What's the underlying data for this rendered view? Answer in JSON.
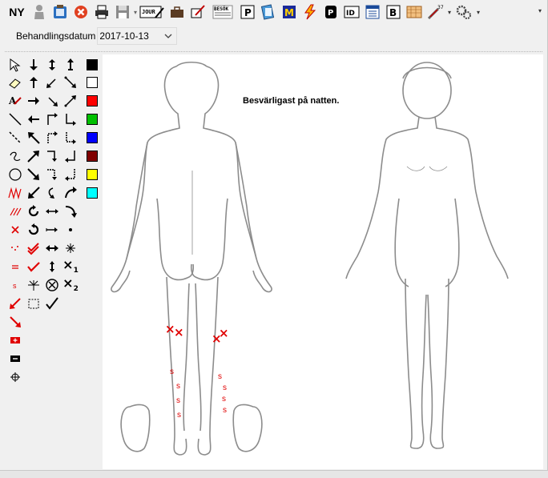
{
  "toolbar": {
    "new_label": "NY",
    "items": [
      {
        "name": "user-icon"
      },
      {
        "name": "record-icon"
      },
      {
        "name": "delete-icon"
      },
      {
        "name": "print-icon"
      },
      {
        "name": "save-icon"
      },
      {
        "name": "journal-icon",
        "text": "JOUR"
      },
      {
        "name": "briefcase-icon"
      },
      {
        "name": "sign-icon"
      },
      {
        "name": "visit-icon",
        "text": "BESÖK"
      },
      {
        "name": "p-icon",
        "text": "P"
      },
      {
        "name": "notes-icon"
      },
      {
        "name": "m-icon",
        "text": "M"
      },
      {
        "name": "lightning-icon"
      },
      {
        "name": "phone-icon"
      },
      {
        "name": "id-icon",
        "text": "ID"
      },
      {
        "name": "calendar-icon"
      },
      {
        "name": "b-icon",
        "text": "B"
      },
      {
        "name": "map-icon"
      },
      {
        "name": "syringe-icon",
        "text": "37"
      },
      {
        "name": "settings-icon"
      }
    ]
  },
  "date": {
    "label": "Behandlingsdatum",
    "value": "2017-10-13"
  },
  "palette": {
    "colors": [
      "#000000",
      "#ffffff",
      "#ff0000",
      "#00c000",
      "#0000ff",
      "#800000",
      "#ffff00",
      "#00ffff"
    ],
    "subscript1": "×",
    "sub1": "1",
    "subscript2": "×",
    "sub2": "2"
  },
  "canvas": {
    "note": "Besvärligast på natten.",
    "x_mark": "×",
    "s_mark": "s"
  }
}
